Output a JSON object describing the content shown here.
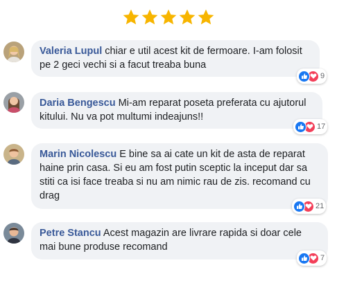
{
  "rating": {
    "stars": 5,
    "max": 5,
    "color": "#f7b500"
  },
  "colors": {
    "author": "#385898",
    "bubble": "#f0f2f5",
    "like": "#1877f2",
    "love": "#f33e58"
  },
  "comments": [
    {
      "author": "Valeria Lupul",
      "text": "chiar e util acest kit de fermoare. I-am folosit pe 2 geci vechi si a facut treaba buna",
      "reactions": [
        "like-icon",
        "love-icon"
      ],
      "count": "9"
    },
    {
      "author": "Daria Bengescu",
      "text": "Mi-am reparat poseta preferata cu ajutorul kitului. Nu va pot multumi indeajuns!!",
      "reactions": [
        "like-icon",
        "love-icon"
      ],
      "count": "17"
    },
    {
      "author": "Marin Nicolescu",
      "text": "E bine sa ai cate un kit de asta de reparat haine prin casa. Si eu am fost putin sceptic la inceput dar sa stiti ca isi face treaba si nu am nimic rau de zis. recomand cu drag",
      "reactions": [
        "like-icon",
        "love-icon"
      ],
      "count": "21"
    },
    {
      "author": "Petre Stancu",
      "text": "Acest magazin are livrare rapida si doar cele mai bune produse recomand",
      "reactions": [
        "like-icon",
        "love-icon"
      ],
      "count": "7"
    }
  ]
}
